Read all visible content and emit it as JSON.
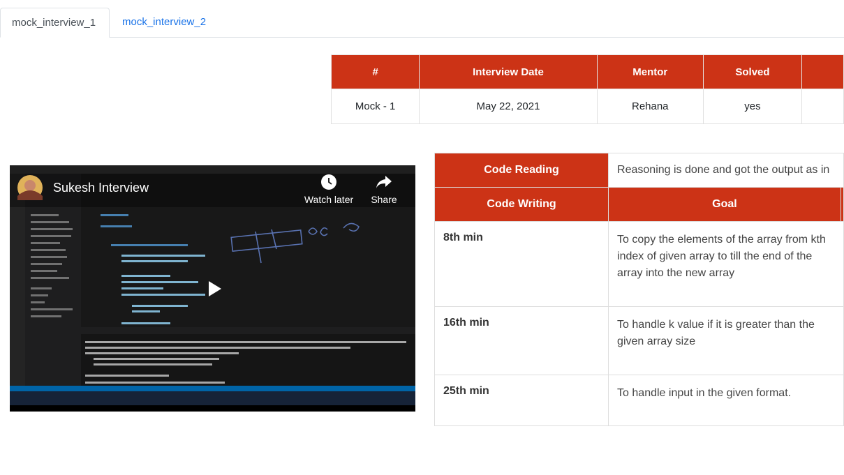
{
  "tabs": [
    {
      "label": "mock_interview_1",
      "active": true
    },
    {
      "label": "mock_interview_2",
      "active": false
    }
  ],
  "summary_table": {
    "headers": [
      "#",
      "Interview Date",
      "Mentor",
      "Solved",
      ""
    ],
    "rows": [
      [
        "Mock - 1",
        "May 22, 2021",
        "Rehana",
        "yes",
        ""
      ]
    ]
  },
  "video": {
    "title": "Sukesh Interview",
    "watch_later_label": "Watch later",
    "share_label": "Share",
    "accent_color": "#cc3316"
  },
  "feedback_table": {
    "code_reading_label": "Code Reading",
    "code_reading_value": "Reasoning is done and got the output as in",
    "code_writing_label": "Code Writing",
    "goal_label": "Goal",
    "rows": [
      {
        "time": "8th min",
        "goal": "To copy the elements of the array from kth index of given array to till the end of the array into the new array"
      },
      {
        "time": "16th min",
        "goal": "To handle k value if it is greater than the given array size"
      },
      {
        "time": "25th min",
        "goal": "To handle input in the given format."
      }
    ]
  }
}
